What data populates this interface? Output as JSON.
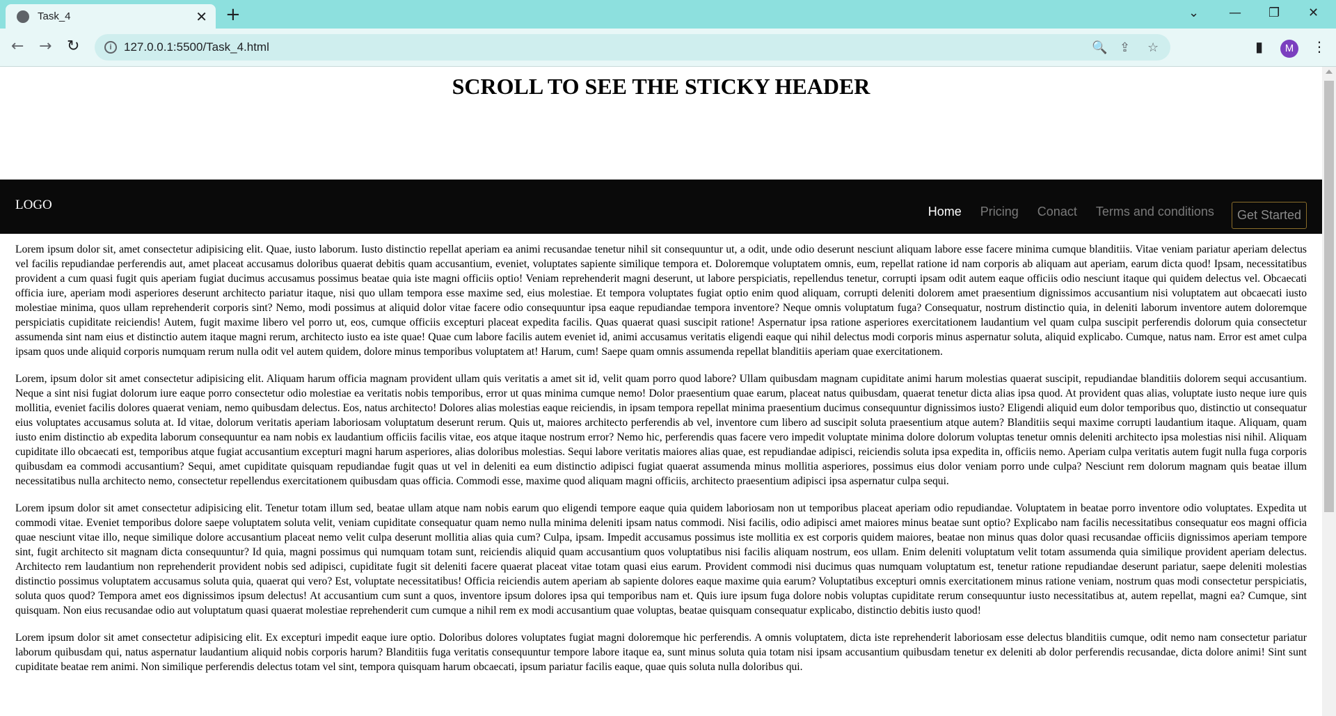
{
  "browser": {
    "tab_title": "Task_4",
    "tab_close": "✕",
    "new_tab": "+",
    "url": "127.0.0.1:5500/Task_4.html",
    "profile_initial": "M",
    "icons": {
      "favicon": "globe-icon",
      "back": "←",
      "forward": "→",
      "reload": "↻",
      "zoom": "🔍",
      "share": "⇪",
      "star": "☆",
      "sidepanel": "▮",
      "menu": "⋮",
      "tabs_dropdown": "⌄",
      "minimize": "—",
      "restore": "❐",
      "close": "✕"
    }
  },
  "page": {
    "heading": "SCROLL TO SEE THE STICKY HEADER",
    "header": {
      "logo": "LOGO",
      "nav": [
        {
          "label": "Home",
          "active": true
        },
        {
          "label": "Pricing",
          "active": false
        },
        {
          "label": "Conact",
          "active": false
        },
        {
          "label": "Terms and conditions",
          "active": false
        }
      ],
      "cta": "Get Started"
    },
    "paragraphs": [
      "Lorem ipsum dolor sit, amet consectetur adipisicing elit. Quae, iusto laborum. Iusto distinctio repellat aperiam ea animi recusandae tenetur nihil sit consequuntur ut, a odit, unde odio deserunt nesciunt aliquam labore esse facere minima cumque blanditiis. Vitae veniam pariatur aperiam delectus vel facilis repudiandae perferendis aut, amet placeat accusamus doloribus quaerat debitis quam accusantium, eveniet, voluptates sapiente similique tempora et. Doloremque voluptatem omnis, eum, repellat ratione id nam corporis ab aliquam aut aperiam, earum dicta quod! Ipsam, necessitatibus provident a cum quasi fugit quis aperiam fugiat ducimus accusamus possimus beatae quia iste magni officiis optio! Veniam reprehenderit magni deserunt, ut labore perspiciatis, repellendus tenetur, corrupti ipsam odit autem eaque officiis odio nesciunt itaque qui quidem delectus vel. Obcaecati officia iure, aperiam modi asperiores deserunt architecto pariatur itaque, nisi quo ullam tempora esse maxime sed, eius molestiae. Et tempora voluptates fugiat optio enim quod aliquam, corrupti deleniti dolorem amet praesentium dignissimos accusantium nisi voluptatem aut obcaecati iusto molestiae minima, quos ullam reprehenderit corporis sint? Nemo, modi possimus at aliquid dolor vitae facere odio consequuntur ipsa eaque repudiandae tempora inventore? Neque omnis voluptatum fuga? Consequatur, nostrum distinctio quia, in deleniti laborum inventore autem doloremque perspiciatis cupiditate reiciendis! Autem, fugit maxime libero vel porro ut, eos, cumque officiis excepturi placeat expedita facilis. Quas quaerat quasi suscipit ratione! Aspernatur ipsa ratione asperiores exercitationem laudantium vel quam culpa suscipit perferendis dolorum quia consectetur assumenda sint nam eius et distinctio autem itaque magni rerum, architecto iusto ea iste quae! Quae cum labore facilis autem eveniet id, animi accusamus veritatis eligendi eaque qui nihil delectus modi corporis minus aspernatur soluta, aliquid explicabo. Cumque, natus nam. Error est amet culpa ipsam quos unde aliquid corporis numquam rerum nulla odit vel autem quidem, dolore minus temporibus voluptatem at! Harum, cum! Saepe quam omnis assumenda repellat blanditiis aperiam quae exercitationem.",
      "Lorem, ipsum dolor sit amet consectetur adipisicing elit. Aliquam harum officia magnam provident ullam quis veritatis a amet sit id, velit quam porro quod labore? Ullam quibusdam magnam cupiditate animi harum molestias quaerat suscipit, repudiandae blanditiis dolorem sequi accusantium. Neque a sint nisi fugiat dolorum iure eaque porro consectetur odio molestiae ea veritatis nobis temporibus, error ut quas minima cumque nemo! Dolor praesentium quae earum, placeat natus quibusdam, quaerat tenetur dicta alias ipsa quod. At provident quas alias, voluptate iusto neque iure quis mollitia, eveniet facilis dolores quaerat veniam, nemo quibusdam delectus. Eos, natus architecto! Dolores alias molestias eaque reiciendis, in ipsam tempora repellat minima praesentium ducimus consequuntur dignissimos iusto? Eligendi aliquid eum dolor temporibus quo, distinctio ut consequatur eius voluptates accusamus soluta at. Id vitae, dolorum veritatis aperiam laboriosam voluptatum deserunt rerum. Quis ut, maiores architecto perferendis ab vel, inventore cum libero ad suscipit soluta praesentium atque autem? Blanditiis sequi maxime corrupti laudantium itaque. Aliquam, quam iusto enim distinctio ab expedita laborum consequuntur ea nam nobis ex laudantium officiis facilis vitae, eos atque itaque nostrum error? Nemo hic, perferendis quas facere vero impedit voluptate minima dolore dolorum voluptas tenetur omnis deleniti architecto ipsa molestias nisi nihil. Aliquam cupiditate illo obcaecati est, temporibus atque fugiat accusantium excepturi magni harum asperiores, alias doloribus molestias. Sequi labore veritatis maiores alias quae, est repudiandae adipisci, reiciendis soluta ipsa expedita in, officiis nemo. Aperiam culpa veritatis autem fugit nulla fuga corporis quibusdam ea commodi accusantium? Sequi, amet cupiditate quisquam repudiandae fugit quas ut vel in deleniti ea eum distinctio adipisci fugiat quaerat assumenda minus mollitia asperiores, possimus eius dolor veniam porro unde culpa? Nesciunt rem dolorum magnam quis beatae illum necessitatibus nulla architecto nemo, consectetur repellendus exercitationem quibusdam quas officia. Commodi esse, maxime quod aliquam magni officiis, architecto praesentium adipisci ipsa aspernatur culpa sequi.",
      "Lorem ipsum dolor sit amet consectetur adipisicing elit. Tenetur totam illum sed, beatae ullam atque nam nobis earum quo eligendi tempore eaque quia quidem laboriosam non ut temporibus placeat aperiam odio repudiandae. Voluptatem in beatae porro inventore odio voluptates. Expedita ut commodi vitae. Eveniet temporibus dolore saepe voluptatem soluta velit, veniam cupiditate consequatur quam nemo nulla minima deleniti ipsam natus commodi. Nisi facilis, odio adipisci amet maiores minus beatae sunt optio? Explicabo nam facilis necessitatibus consequatur eos magni officia quae nesciunt vitae illo, neque similique dolore accusantium placeat nemo velit culpa deserunt mollitia alias quia cum? Culpa, ipsam. Impedit accusamus possimus iste mollitia ex est corporis quidem maiores, beatae non minus quas dolor quasi recusandae officiis dignissimos aperiam tempore sint, fugit architecto sit magnam dicta consequuntur? Id quia, magni possimus qui numquam totam sunt, reiciendis aliquid quam accusantium quos voluptatibus nisi facilis aliquam nostrum, eos ullam. Enim deleniti voluptatum velit totam assumenda quia similique provident aperiam delectus. Architecto rem laudantium non reprehenderit provident nobis sed adipisci, cupiditate fugit sit deleniti facere quaerat placeat vitae totam quasi eius earum. Provident commodi nisi ducimus quas numquam voluptatum est, tenetur ratione repudiandae deserunt pariatur, saepe deleniti molestias distinctio possimus voluptatem accusamus soluta quia, quaerat qui vero? Est, voluptate necessitatibus! Officia reiciendis autem aperiam ab sapiente dolores eaque maxime quia earum? Voluptatibus excepturi omnis exercitationem minus ratione veniam, nostrum quas modi consectetur perspiciatis, soluta quos quod? Tempora amet eos dignissimos ipsum delectus! At accusantium cum sunt a quos, inventore ipsum dolores ipsa qui temporibus nam et. Quis iure ipsum fuga dolore nobis voluptas cupiditate rerum consequuntur iusto necessitatibus at, autem repellat, magni ea? Cumque, sint quisquam. Non eius recusandae odio aut voluptatum quasi quaerat molestiae reprehenderit cum cumque a nihil rem ex modi accusantium quae voluptas, beatae quisquam consequatur explicabo, distinctio debitis iusto quod!",
      "Lorem ipsum dolor sit amet consectetur adipisicing elit. Ex excepturi impedit eaque iure optio. Doloribus dolores voluptates fugiat magni doloremque hic perferendis. A omnis voluptatem, dicta iste reprehenderit laboriosam esse delectus blanditiis cumque, odit nemo nam consectetur pariatur laborum quibusdam qui, natus aspernatur laudantium aliquid nobis corporis harum? Blanditiis fuga veritatis consequuntur tempore labore itaque ea, sunt minus soluta quia totam nisi ipsam accusantium quibusdam tenetur ex deleniti ab dolor perferendis recusandae, dicta dolore animi! Sint sunt cupiditate beatae rem animi. Non similique perferendis delectus totam vel sint, tempora quisquam harum obcaecati, ipsum pariatur facilis eaque, quae quis soluta nulla doloribus qui."
    ]
  }
}
